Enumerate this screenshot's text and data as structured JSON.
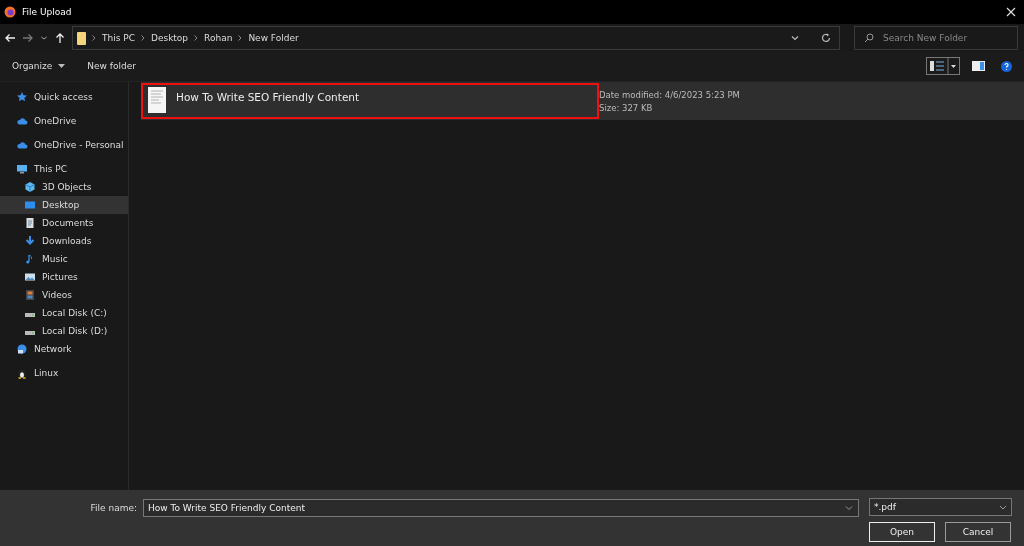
{
  "window": {
    "title": "File Upload"
  },
  "address": {
    "crumbs": [
      "This PC",
      "Desktop",
      "Rohan",
      "New Folder"
    ]
  },
  "search": {
    "placeholder": "Search New Folder"
  },
  "toolbar": {
    "organize": "Organize",
    "new_folder": "New folder"
  },
  "sidebar": {
    "items": [
      {
        "label": "Quick access",
        "kind": "star",
        "selected": false
      },
      {
        "label": "OneDrive",
        "kind": "cloud",
        "selected": false
      },
      {
        "label": "OneDrive - Personal",
        "kind": "cloud",
        "selected": false
      },
      {
        "label": "This PC",
        "kind": "pc",
        "selected": false,
        "children": [
          {
            "label": "3D Objects",
            "kind": "cube",
            "selected": false
          },
          {
            "label": "Desktop",
            "kind": "desktop",
            "selected": true
          },
          {
            "label": "Documents",
            "kind": "docs",
            "selected": false
          },
          {
            "label": "Downloads",
            "kind": "download",
            "selected": false
          },
          {
            "label": "Music",
            "kind": "music",
            "selected": false
          },
          {
            "label": "Pictures",
            "kind": "pictures",
            "selected": false
          },
          {
            "label": "Videos",
            "kind": "videos",
            "selected": false
          },
          {
            "label": "Local Disk (C:)",
            "kind": "disk",
            "selected": false
          },
          {
            "label": "Local Disk (D:)",
            "kind": "disk",
            "selected": false
          }
        ]
      },
      {
        "label": "Network",
        "kind": "network",
        "selected": false
      },
      {
        "label": "Linux",
        "kind": "linux",
        "selected": false
      }
    ]
  },
  "files": [
    {
      "name": "How To Write SEO Friendly Content",
      "date_modified": "Date modified: 4/6/2023 5:23 PM",
      "size": "Size: 327 KB",
      "selected": true
    }
  ],
  "footer": {
    "file_name_label": "File name:",
    "file_name": "How To Write SEO Friendly Content",
    "filter": "*.pdf",
    "buttons": [
      "Open",
      "Cancel"
    ]
  }
}
